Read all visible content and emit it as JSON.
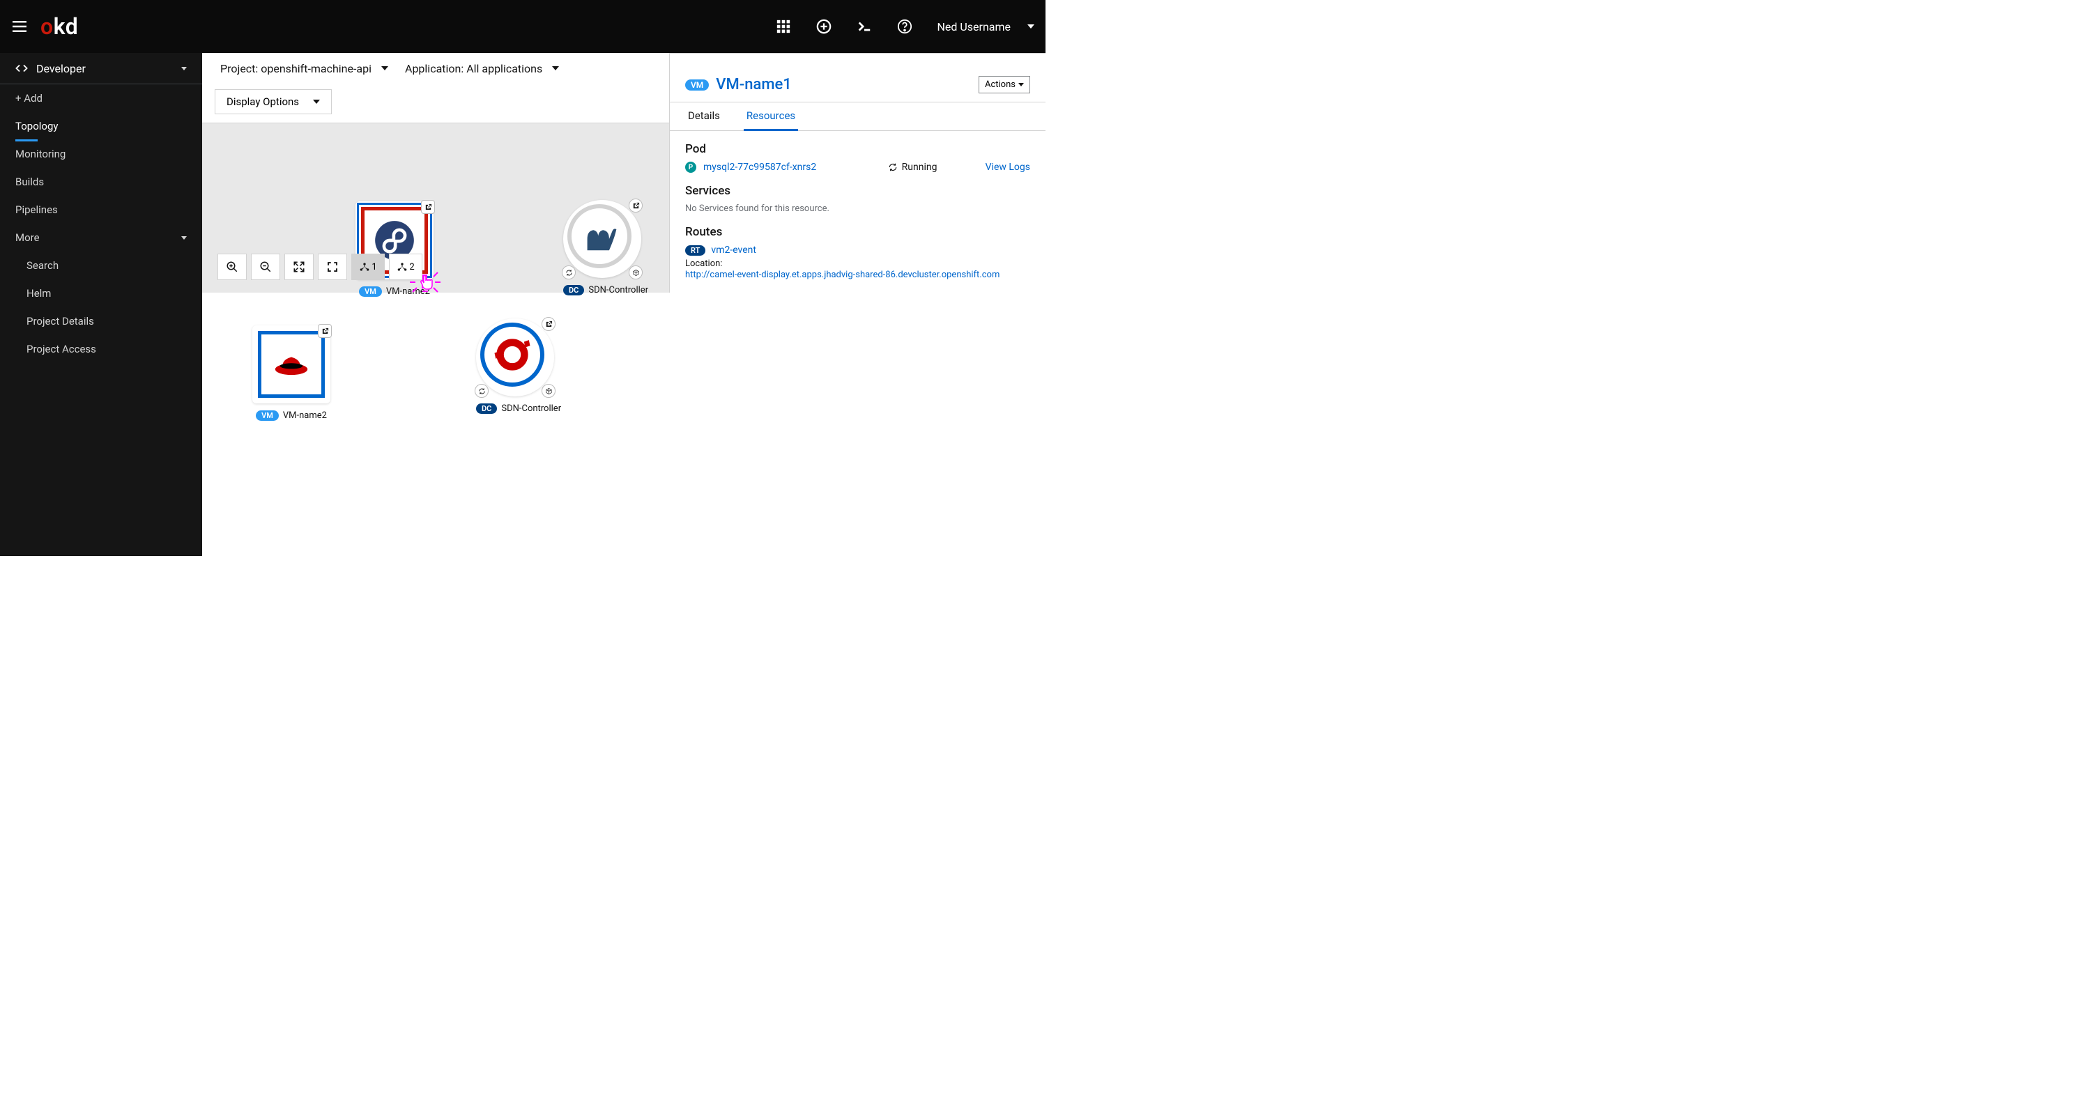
{
  "masthead": {
    "logo_part1": "o",
    "logo_part2": "kd",
    "username": "Ned Username"
  },
  "sidebar": {
    "perspective": "Developer",
    "items": [
      {
        "label": "+ Add"
      },
      {
        "label": "Topology",
        "active": true
      },
      {
        "label": "Monitoring"
      },
      {
        "label": "Builds"
      },
      {
        "label": "Pipelines"
      },
      {
        "label": "More",
        "expandable": true
      }
    ],
    "subitems": [
      {
        "label": "Search"
      },
      {
        "label": "Helm"
      },
      {
        "label": "Project Details"
      },
      {
        "label": "Project Access"
      }
    ]
  },
  "toolbar": {
    "project_label": "Project: openshift-machine-api",
    "application_label": "Application: All applications",
    "display_options": "Display Options"
  },
  "nodes": {
    "fedora": {
      "badge": "VM",
      "name": "VM-name2"
    },
    "rhel": {
      "badge": "VM",
      "name": "VM-name2"
    },
    "camel": {
      "badge": "DC",
      "name": "SDN-Controller"
    },
    "openshift": {
      "badge": "DC",
      "name": "SDN-Controller"
    }
  },
  "canvas_footer": {
    "layout1_count": "1",
    "layout2_count": "2"
  },
  "sidepanel": {
    "badge": "VM",
    "title": "VM-name1",
    "actions_label": "Actions",
    "tabs": [
      {
        "label": "Details"
      },
      {
        "label": "Resources",
        "active": true
      }
    ],
    "pod": {
      "heading": "Pod",
      "badge": "P",
      "name": "mysql2-77c99587cf-xnrs2",
      "status": "Running",
      "view_logs": "View Logs"
    },
    "services": {
      "heading": "Services",
      "empty_msg": "No Services found for this resource."
    },
    "routes": {
      "heading": "Routes",
      "badge": "RT",
      "name": "vm2-event",
      "location_label": "Location:",
      "location_url": "http://camel-event-display.et.apps.jhadvig-shared-86.devcluster.openshift.com"
    }
  }
}
